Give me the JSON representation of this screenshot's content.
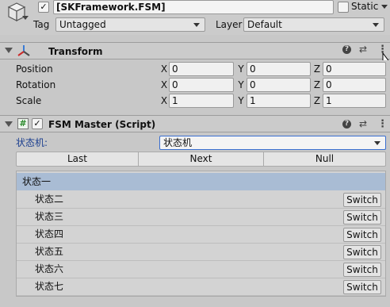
{
  "header": {
    "object_name": "[SKFramework.FSM]",
    "static_label": "Static",
    "tag_label": "Tag",
    "tag_value": "Untagged",
    "layer_label": "Layer",
    "layer_value": "Default"
  },
  "transform": {
    "title": "Transform",
    "rows": [
      {
        "label": "Position",
        "x": "0",
        "y": "0",
        "z": "0"
      },
      {
        "label": "Rotation",
        "x": "0",
        "y": "0",
        "z": "0"
      },
      {
        "label": "Scale",
        "x": "1",
        "y": "1",
        "z": "1"
      }
    ],
    "axis": {
      "x": "X",
      "y": "Y",
      "z": "Z"
    }
  },
  "fsm": {
    "title": "FSM Master (Script)",
    "field_label": "状态机:",
    "field_value": "状态机",
    "nav": {
      "last": "Last",
      "next": "Next",
      "null": "Null"
    },
    "current_state": "状态一",
    "switch_label": "Switch",
    "states": [
      "状态二",
      "状态三",
      "状态四",
      "状态五",
      "状态六",
      "状态七"
    ]
  },
  "icons": {
    "help": "help-icon",
    "preset": "preset-icon",
    "menu": "kebab-menu-icon"
  }
}
